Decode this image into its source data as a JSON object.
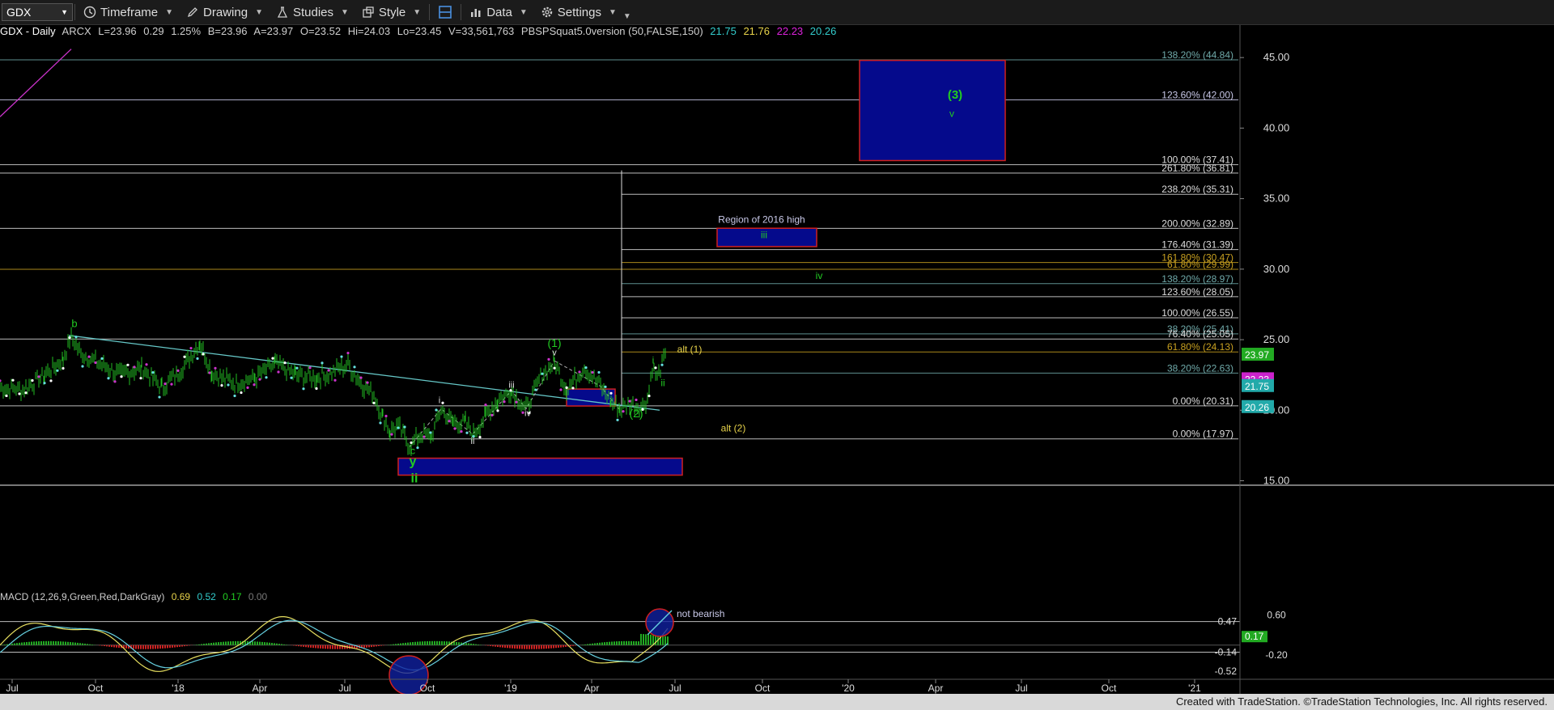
{
  "toolbar": {
    "symbol": "GDX",
    "timeframe": "Timeframe",
    "drawing": "Drawing",
    "studies": "Studies",
    "style": "Style",
    "data": "Data",
    "settings": "Settings"
  },
  "infobar": {
    "title": "GDX - Daily",
    "exchange": "ARCX",
    "last": "L=23.96",
    "chg": "0.29",
    "pct": "1.25%",
    "bid": "B=23.96",
    "ask": "A=23.97",
    "open": "O=23.52",
    "hi": "Hi=24.03",
    "lo": "Lo=23.45",
    "vol": "V=33,561,763",
    "study": "PBSPSquat5.0version (50,FALSE,150)",
    "v1": "21.75",
    "v2": "21.76",
    "v3": "22.23",
    "v4": "20.26"
  },
  "macd": {
    "label": "MACD (12,26,9,Green,Red,DarkGray)",
    "v1": "0.69",
    "v2": "0.52",
    "v3": "0.17",
    "v4": "0.00",
    "axis_labels": [
      "0.60",
      "-0.20"
    ],
    "value_labels": [
      {
        "text": "0.47",
        "value": 0.47,
        "bg": "",
        "color": "#dddddd"
      },
      {
        "text": "0.17",
        "value": 0.17,
        "bg": "#22aa22",
        "color": "#ffffff"
      },
      {
        "text": "-0.14",
        "value": -0.14,
        "bg": "",
        "color": "#dddddd"
      },
      {
        "text": "-0.52",
        "value": -0.52,
        "bg": "",
        "color": "#dddddd"
      }
    ],
    "annotation": "not bearish"
  },
  "chart_data": {
    "type": "line",
    "symbol": "GDX",
    "price_axis": [
      "45.00",
      "40.00",
      "35.00",
      "30.00",
      "25.00",
      "20.00",
      "15.00"
    ],
    "ylim": [
      14.8,
      46.5
    ],
    "time_axis": [
      "Jul",
      "Oct",
      "'18",
      "Apr",
      "Jul",
      "Oct",
      "'19",
      "Apr",
      "Jul",
      "Oct",
      "'20",
      "Apr",
      "Jul",
      "Oct",
      "'21"
    ],
    "price_path": [
      {
        "t": 0,
        "p": 21.6
      },
      {
        "t": 30,
        "p": 21.5
      },
      {
        "t": 55,
        "p": 22.5
      },
      {
        "t": 78,
        "p": 23.6
      },
      {
        "t": 88,
        "p": 25.2
      },
      {
        "t": 100,
        "p": 24.0
      },
      {
        "t": 120,
        "p": 23.4
      },
      {
        "t": 150,
        "p": 22.5
      },
      {
        "t": 175,
        "p": 23.0
      },
      {
        "t": 200,
        "p": 21.6
      },
      {
        "t": 220,
        "p": 22.6
      },
      {
        "t": 247,
        "p": 24.8
      },
      {
        "t": 262,
        "p": 22.6
      },
      {
        "t": 290,
        "p": 21.9
      },
      {
        "t": 315,
        "p": 22.3
      },
      {
        "t": 340,
        "p": 23.3
      },
      {
        "t": 365,
        "p": 22.5
      },
      {
        "t": 392,
        "p": 22.3
      },
      {
        "t": 410,
        "p": 22.7
      },
      {
        "t": 430,
        "p": 23.2
      },
      {
        "t": 448,
        "p": 21.8
      },
      {
        "t": 462,
        "p": 21.1
      },
      {
        "t": 473,
        "p": 19.5
      },
      {
        "t": 482,
        "p": 18.5
      },
      {
        "t": 492,
        "p": 18.9
      },
      {
        "t": 506,
        "p": 17.4
      },
      {
        "t": 520,
        "p": 18.3
      },
      {
        "t": 533,
        "p": 18.1
      },
      {
        "t": 545,
        "p": 20.1
      },
      {
        "t": 560,
        "p": 19.1
      },
      {
        "t": 575,
        "p": 19.1
      },
      {
        "t": 585,
        "p": 18.3
      },
      {
        "t": 600,
        "p": 19.6
      },
      {
        "t": 615,
        "p": 20.7
      },
      {
        "t": 632,
        "p": 21.4
      },
      {
        "t": 650,
        "p": 20.1
      },
      {
        "t": 668,
        "p": 22.4
      },
      {
        "t": 685,
        "p": 23.4
      },
      {
        "t": 700,
        "p": 21.5
      },
      {
        "t": 722,
        "p": 23.0
      },
      {
        "t": 742,
        "p": 21.7
      },
      {
        "t": 755,
        "p": 20.6
      },
      {
        "t": 766,
        "p": 20.0
      },
      {
        "t": 778,
        "p": 20.5
      },
      {
        "t": 792,
        "p": 20.2
      },
      {
        "t": 800,
        "p": 20.8
      },
      {
        "t": 806,
        "p": 23.1
      },
      {
        "t": 812,
        "p": 22.3
      },
      {
        "t": 822,
        "p": 23.96
      }
    ],
    "fib_levels": [
      {
        "label": "138.20% (44.84)",
        "value": 44.84,
        "color": "#6fa9a9",
        "from": 0
      },
      {
        "label": "123.60% (42.00)",
        "value": 42.0,
        "color": "#c8c8e8",
        "from": 0
      },
      {
        "label": "100.00% (37.41)",
        "value": 37.41,
        "color": "#dddddd",
        "from": 0
      },
      {
        "label": "261.80% (36.81)",
        "value": 36.81,
        "color": "#dddddd",
        "from": 0
      },
      {
        "label": "238.20% (35.31)",
        "value": 35.31,
        "color": "#dddddd",
        "from": 768
      },
      {
        "label": "200.00% (32.89)",
        "value": 32.89,
        "color": "#dddddd",
        "from": 0
      },
      {
        "label": "176.40% (31.39)",
        "value": 31.39,
        "color": "#dddddd",
        "from": 768
      },
      {
        "label": "161.80% (30.47)",
        "value": 30.47,
        "color": "#c8a020",
        "from": 768
      },
      {
        "label": "61.80% (29.99)",
        "value": 29.99,
        "color": "#c8a020",
        "from": 0
      },
      {
        "label": "138.20% (28.97)",
        "value": 28.97,
        "color": "#6fa9a9",
        "from": 768
      },
      {
        "label": "123.60% (28.05)",
        "value": 28.05,
        "color": "#dddddd",
        "from": 768
      },
      {
        "label": "100.00% (26.55)",
        "value": 26.55,
        "color": "#dddddd",
        "from": 768
      },
      {
        "label": "38.20% (25.41)",
        "value": 25.41,
        "color": "#6fa9a9",
        "from": 768
      },
      {
        "label": "76.40% (25.05)",
        "value": 25.05,
        "color": "#dddddd",
        "from": 0
      },
      {
        "label": "61.80% (24.13)",
        "value": 24.13,
        "color": "#c8a020",
        "from": 768
      },
      {
        "label": "38.20% (22.63)",
        "value": 22.63,
        "color": "#6fa9a9",
        "from": 768
      },
      {
        "label": "0.00% (20.31)",
        "value": 20.31,
        "color": "#dddddd",
        "from": 0
      },
      {
        "label": "0.00% (17.97)",
        "value": 17.97,
        "color": "#dddddd",
        "from": 0
      }
    ],
    "right_labels": [
      {
        "text": "23.97",
        "value": 23.97,
        "bg": "#22aa22"
      },
      {
        "text": "22.23",
        "value": 22.23,
        "bg": "#cc22cc"
      },
      {
        "text": "21.75",
        "value": 21.75,
        "bg": "#22aaaa"
      },
      {
        "text": "20.26",
        "value": 20.26,
        "bg": "#22aaaa"
      }
    ],
    "boxes": [
      {
        "name": "target-box-wave-3",
        "t1": 1062,
        "t2": 1242,
        "p1": 37.7,
        "p2": 44.8
      },
      {
        "name": "target-box-wave-iii",
        "t1": 886,
        "t2": 1009,
        "p1": 31.6,
        "p2": 32.9
      },
      {
        "name": "support-box-bottom",
        "t1": 492,
        "t2": 843,
        "p1": 15.4,
        "p2": 16.6
      },
      {
        "name": "support-box-apr",
        "t1": 700,
        "t2": 760,
        "p1": 20.3,
        "p2": 21.5
      }
    ],
    "labels": [
      {
        "text": "b",
        "t": 92,
        "p": 25.9,
        "color": "#22cc22",
        "size": 13
      },
      {
        "text": "(1)",
        "t": 685,
        "p": 24.5,
        "color": "#22cc22",
        "size": 14
      },
      {
        "text": "alt (1)",
        "t": 852,
        "p": 24.1,
        "color": "#e8d34a",
        "size": 12
      },
      {
        "text": "i",
        "t": 807,
        "p": 23.3,
        "color": "#22cc22",
        "size": 12
      },
      {
        "text": "ii",
        "t": 819,
        "p": 21.7,
        "color": "#22cc22",
        "size": 12
      },
      {
        "text": "(2)",
        "t": 786,
        "p": 19.5,
        "color": "#22cc22",
        "size": 14
      },
      {
        "text": "alt (2)",
        "t": 906,
        "p": 18.5,
        "color": "#e8d34a",
        "size": 12
      },
      {
        "text": "i",
        "t": 543,
        "p": 20.5,
        "color": "#dddddd",
        "size": 11
      },
      {
        "text": "ii",
        "t": 584,
        "p": 17.6,
        "color": "#dddddd",
        "size": 11
      },
      {
        "text": "iii",
        "t": 632,
        "p": 21.6,
        "color": "#dddddd",
        "size": 11
      },
      {
        "text": "iv",
        "t": 652,
        "p": 19.6,
        "color": "#dddddd",
        "size": 11
      },
      {
        "text": "v",
        "t": 685,
        "p": 23.9,
        "color": "#dddddd",
        "size": 11
      },
      {
        "text": "c",
        "t": 510,
        "p": 16.9,
        "color": "#22cc22",
        "size": 12
      },
      {
        "text": "y",
        "t": 510,
        "p": 16.1,
        "color": "#22cc22",
        "size": 16
      },
      {
        "text": "ii",
        "t": 512,
        "p": 14.9,
        "color": "#22cc22",
        "size": 16
      },
      {
        "text": "Region of 2016 high",
        "t": 941,
        "p": 33.3,
        "color": "#c8c8e8",
        "size": 12
      },
      {
        "text": "iii",
        "t": 944,
        "p": 32.2,
        "color": "#22cc22",
        "size": 12
      },
      {
        "text": "iv",
        "t": 1012,
        "p": 29.3,
        "color": "#22cc22",
        "size": 12
      },
      {
        "text": "(3)",
        "t": 1180,
        "p": 42.1,
        "color": "#22cc22",
        "size": 15
      },
      {
        "text": "v",
        "t": 1176,
        "p": 40.8,
        "color": "#22cc22",
        "size": 12
      }
    ]
  },
  "footer": {
    "text": "Created with TradeStation. ©TradeStation Technologies, Inc. All rights reserved."
  }
}
